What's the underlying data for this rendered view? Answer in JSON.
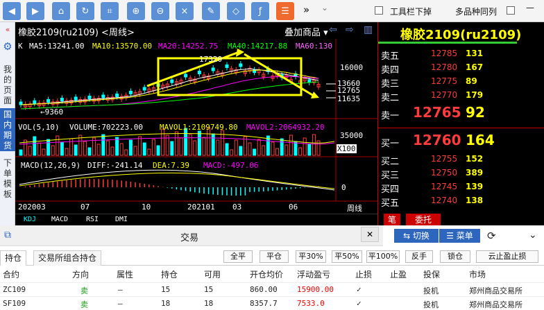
{
  "toolbar": {
    "icons": [
      "back-icon",
      "forward-icon",
      "home-icon",
      "refresh-icon",
      "crop-icon",
      "zoom-in-icon",
      "zoom-out-icon",
      "formula-icon",
      "draw-icon",
      "tag-icon",
      "fx-icon",
      "list-icon"
    ],
    "more": "»",
    "hide_toolbar_label": "工具栏下掉",
    "multi_label": "多品种同列",
    "minimize": "—",
    "close": "✕"
  },
  "sidebar": {
    "items": [
      "我的页面",
      "国内期货",
      "下单模板"
    ]
  },
  "chart": {
    "title": "橡胶2109(ru2109)",
    "period": "<周线>",
    "overlay_btn": "叠加商品",
    "ma_line": {
      "k": "K",
      "ma5": "MA5:13241.00",
      "ma10": "MA10:13570.00",
      "ma20": "MA20:14252.75",
      "ma40": "MA40:14217.88",
      "ma60": "MA60:130"
    },
    "price_high": "17320",
    "price_low": "9360",
    "axis_prices": [
      "16000",
      "13660",
      "12765",
      "11635"
    ],
    "vol_line": {
      "vol": "VOL(5,10)",
      "volume": "VOLUME:702223.00",
      "mavol1": "MAVOL1:2109749.80",
      "mavol2": "MAVOL2:2064932.20"
    },
    "vol_axis": "35000",
    "vol_unit": "X100",
    "macd_line": {
      "macd": "MACD(12,26,9)",
      "diff": "DIFF:-241.14",
      "dea": "DEA:7.39",
      "macdv": "MACD:-497.06"
    },
    "macd_axis": "0",
    "time_axis": [
      "202003",
      "07",
      "10",
      "202101",
      "03",
      "06"
    ],
    "period_label": "周线",
    "indicators": [
      "KDJ",
      "MACD",
      "RSI",
      "DMI"
    ],
    "colors": {
      "ma5": "#ffffff",
      "ma10": "#ffff00",
      "ma20": "#ff00ff",
      "ma40": "#00ff00",
      "ma60": "#ff66ff",
      "up": "#ff3b3b",
      "down": "#00ffff",
      "box": "#ffff00"
    }
  },
  "quote": {
    "title": "橡胶2109(ru2109)",
    "asks": [
      {
        "label": "卖五",
        "price": "12785",
        "vol": "131"
      },
      {
        "label": "卖四",
        "price": "12780",
        "vol": "167"
      },
      {
        "label": "卖三",
        "price": "12775",
        "vol": "89"
      },
      {
        "label": "卖二",
        "price": "12770",
        "vol": "179"
      },
      {
        "label": "卖一",
        "price": "12765",
        "vol": "92"
      }
    ],
    "bids": [
      {
        "label": "买一",
        "price": "12760",
        "vol": "164"
      },
      {
        "label": "买二",
        "price": "12755",
        "vol": "152"
      },
      {
        "label": "买三",
        "price": "12750",
        "vol": "389"
      },
      {
        "label": "买四",
        "price": "12745",
        "vol": "139"
      },
      {
        "label": "买五",
        "price": "12740",
        "vol": "138"
      }
    ],
    "tab_pen": "笔",
    "tab_order": "委托"
  },
  "trade": {
    "title": "交易",
    "close": "✕",
    "switch_btn": "⇆ 切换",
    "menu_btn": "☰ 菜单",
    "tabs": [
      "持仓",
      "交易所组合持仓"
    ],
    "actions": [
      "全平",
      "平仓",
      "平30%",
      "平50%",
      "平100%",
      "反手",
      "锁仓",
      "云止盈止损"
    ],
    "columns": [
      "合约",
      "方向",
      "属性",
      "持仓",
      "可用",
      "开仓均价",
      "浮动盈亏",
      "止损",
      "止盈",
      "投保",
      "市场"
    ],
    "rows": [
      {
        "contract": "ZC109",
        "dir": "卖",
        "attr": "—",
        "pos": "15",
        "avail": "15",
        "price": "860.00",
        "pnl": "15900.00",
        "sl": "✓",
        "tp": "",
        "hedge": "投机",
        "market": "郑州商品交易所"
      },
      {
        "contract": "SF109",
        "dir": "卖",
        "attr": "—",
        "pos": "18",
        "avail": "18",
        "price": "8357.7",
        "pnl": "7533.0",
        "sl": "✓",
        "tp": "",
        "hedge": "投机",
        "market": "郑州商品交易所"
      }
    ]
  }
}
